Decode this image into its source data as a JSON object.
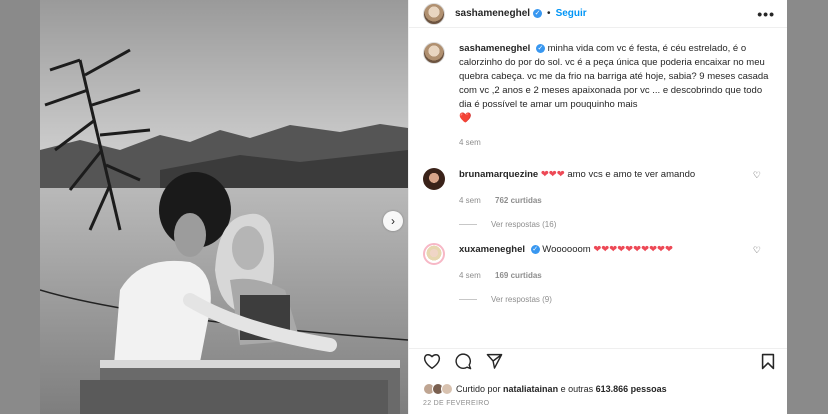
{
  "post": {
    "author": "sashameneghel",
    "follow_label": "Seguir",
    "more_label": "•••",
    "caption": {
      "user": "sashameneghel",
      "text": "minha vida com vc é festa, é céu estrelado, é o calorzinho do por do sol. vc é a peça única que poderia encaixar no meu quebra cabeça. vc me da frio na barriga até hoje, sabia? 9 meses casada com vc ,2 anos e 2 meses apaixonada por vc ... e descobrindo que todo dia é possível te amar um pouquinho mais",
      "emoji": "❤️",
      "time": "4 sem"
    },
    "comments": [
      {
        "user": "brunamarquezine",
        "hearts": "❤❤❤",
        "text": "amo vcs e amo te ver amando",
        "time": "4 sem",
        "likes": "762 curtidas",
        "replies": "Ver respostas (16)"
      },
      {
        "user": "xuxameneghel",
        "text": "Woooooom",
        "hearts": "❤❤❤❤❤❤❤❤❤❤",
        "time": "4 sem",
        "likes": "169 curtidas",
        "replies": "Ver respostas (9)"
      }
    ],
    "liked_by": {
      "prefix": "Curtido por",
      "user": "nataliatainan",
      "suffix": "e outras",
      "count": "613.866 pessoas"
    },
    "date": "22 DE FEVEREIRO",
    "icons": [
      "heart-outline-icon",
      "comment-icon",
      "share-icon",
      "bookmark-icon",
      "chevron-right-icon",
      "verified-icon"
    ]
  }
}
